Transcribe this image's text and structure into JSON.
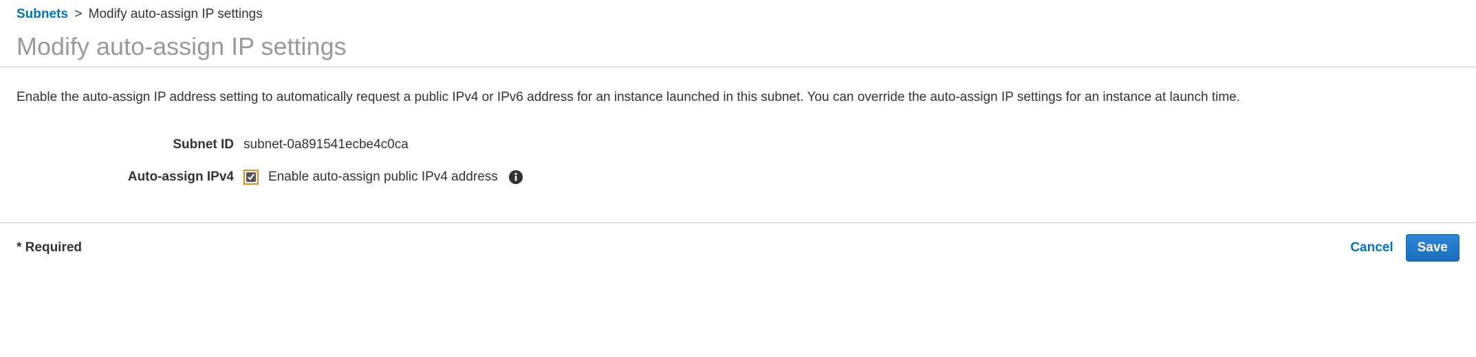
{
  "breadcrumb": {
    "parent_label": "Subnets",
    "separator": ">",
    "current_label": "Modify auto-assign IP settings"
  },
  "page_title": "Modify auto-assign IP settings",
  "description": "Enable the auto-assign IP address setting to automatically request a public IPv4 or IPv6 address for an instance launched in this subnet. You can override the auto-assign IP settings for an instance at launch time.",
  "form": {
    "subnet_id": {
      "label": "Subnet ID",
      "value": "subnet-0a891541ecbe4c0ca"
    },
    "auto_assign_ipv4": {
      "label": "Auto-assign IPv4",
      "checkbox_label": "Enable auto-assign public IPv4 address",
      "checked": true
    }
  },
  "footer": {
    "required_note": "* Required",
    "cancel_label": "Cancel",
    "save_label": "Save"
  }
}
